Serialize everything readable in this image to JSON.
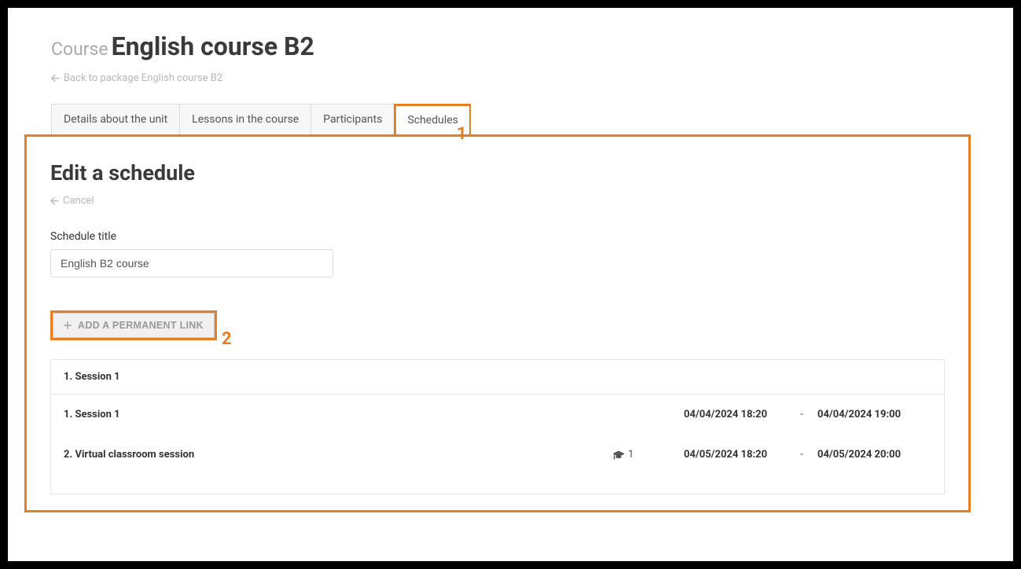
{
  "header": {
    "course_label": "Course",
    "course_title": "English course B2",
    "back_link": "Back to package English course B2"
  },
  "tabs": [
    {
      "label": "Details about the unit"
    },
    {
      "label": "Lessons in the course"
    },
    {
      "label": "Participants"
    },
    {
      "label": "Schedules"
    }
  ],
  "annotations": {
    "tab_marker": "1",
    "button_marker": "2"
  },
  "panel": {
    "title": "Edit a schedule",
    "cancel": "Cancel",
    "field_label": "Schedule title",
    "field_value": "English B2 course",
    "add_button": "ADD A PERMANENT LINK"
  },
  "schedule": {
    "header": "1. Session 1",
    "rows": [
      {
        "title": "1. Session 1",
        "icon_count": "",
        "start": "04/04/2024 18:20",
        "end": "04/04/2024 19:00"
      },
      {
        "title": "2. Virtual classroom session",
        "icon_count": "1",
        "start": "04/05/2024 18:20",
        "end": "04/05/2024 20:00"
      }
    ],
    "dash": "-"
  }
}
